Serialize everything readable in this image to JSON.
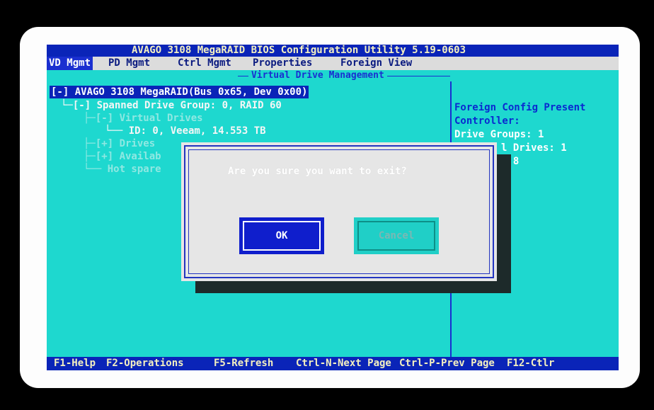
{
  "title": "AVAGO 3108 MegaRAID BIOS Configuration Utility 5.19-0603",
  "menu": [
    "VD Mgmt",
    "PD Mgmt",
    "Ctrl Mgmt",
    "Properties",
    "Foreign View"
  ],
  "section_title": "Virtual Drive Management",
  "tree": [
    "[-] AVAGO 3108 MegaRAID(Bus 0x65, Dev 0x00)",
    "└─[-] Spanned Drive Group: 0, RAID 60",
    "├─[-] Virtual Drives",
    "└── ID: 0, Veeam, 14.553 TB",
    "├─[+] Drives",
    "├─[+] Availab",
    "└── Hot spare"
  ],
  "right_panel": [
    "Foreign Config Present",
    "Controller:",
    "Drive Groups: 1",
    "l Drives: 1",
    ": 8"
  ],
  "dialog": {
    "question": "Are you sure you want to exit?",
    "ok": "OK",
    "cancel": "Cancel"
  },
  "status": [
    "F1-Help",
    "F2-Operations",
    "F5-Refresh",
    "Ctrl-N-Next Page",
    "Ctrl-P-Prev Page",
    "F12-Ctlr"
  ],
  "colors": {
    "screen_bg": "#1ed8cf",
    "bar_blue": "#0a24b8",
    "menu_bg": "#dcdcdc"
  }
}
